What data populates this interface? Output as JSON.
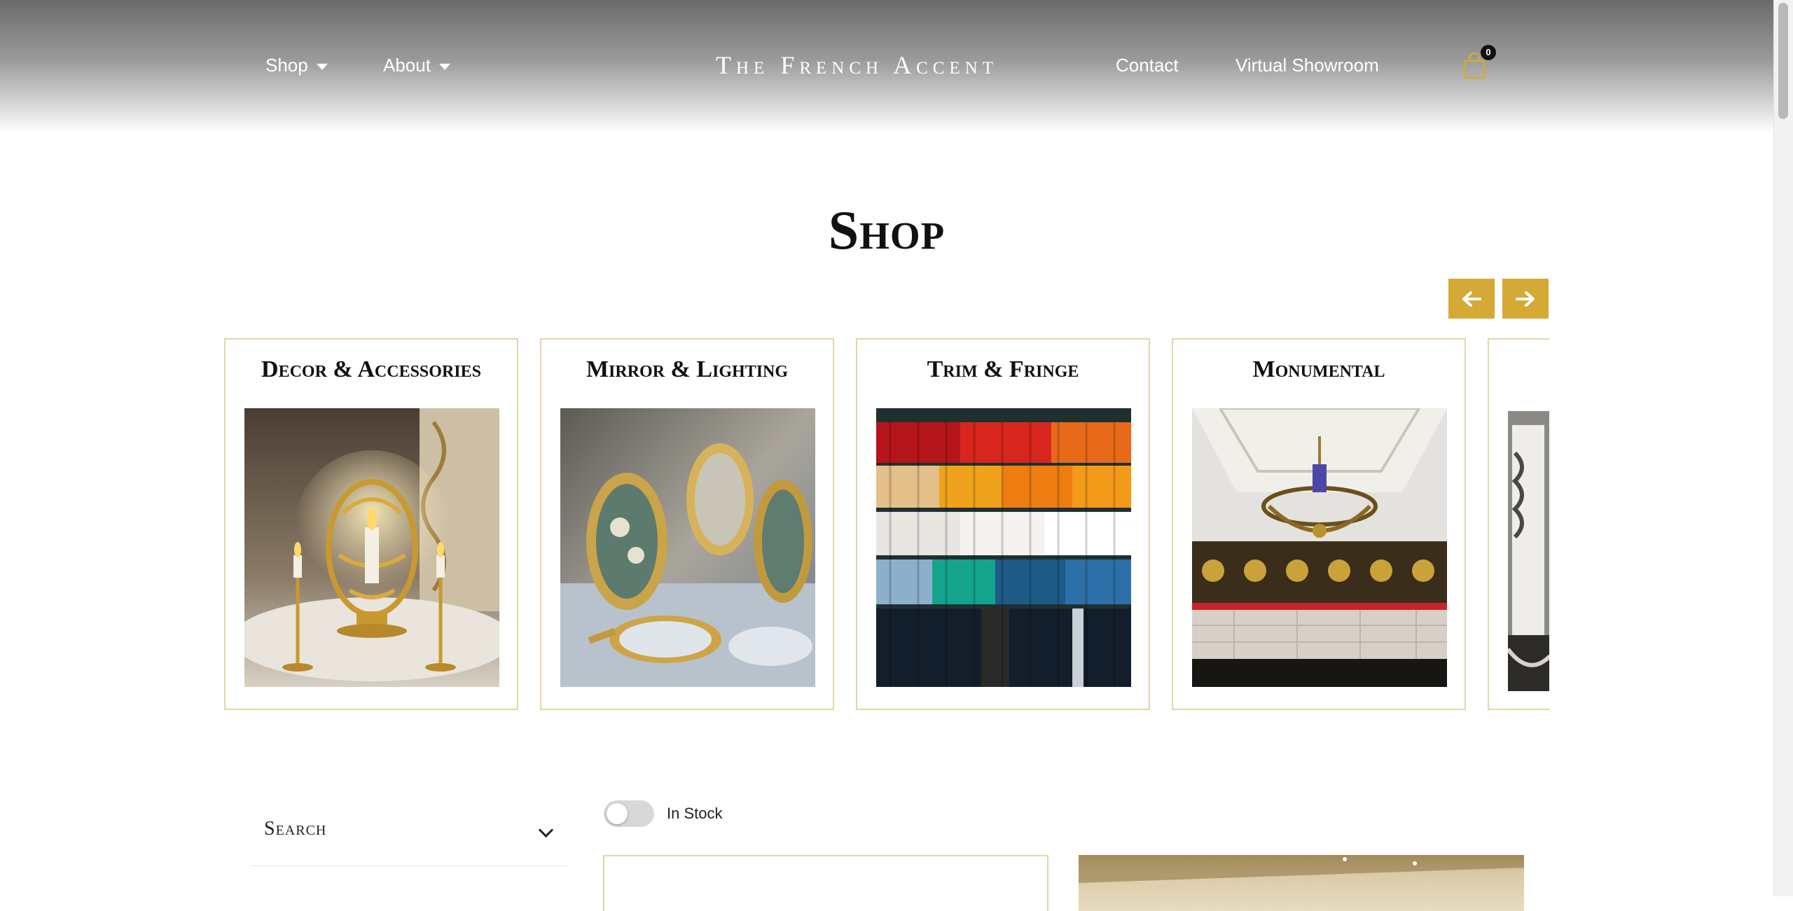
{
  "nav": {
    "shop_label": "Shop",
    "about_label": "About",
    "brand": "The French Accent",
    "contact_label": "Contact",
    "showroom_label": "Virtual Showroom",
    "cart_count": "0"
  },
  "page": {
    "title": "Shop"
  },
  "categories": [
    {
      "label": "Decor & Accessories"
    },
    {
      "label": "Mirror & Lighting"
    },
    {
      "label": "Trim & Fringe"
    },
    {
      "label": "Monumental"
    }
  ],
  "filters": {
    "search_label": "Search",
    "in_stock_label": "In Stock",
    "in_stock_enabled": false
  },
  "colors": {
    "accent": "#d4a935",
    "card_border": "#e3d7a4"
  },
  "icons": [
    "caret-down-icon",
    "cart-icon",
    "arrow-left-icon",
    "arrow-right-icon",
    "chevron-down-icon"
  ]
}
